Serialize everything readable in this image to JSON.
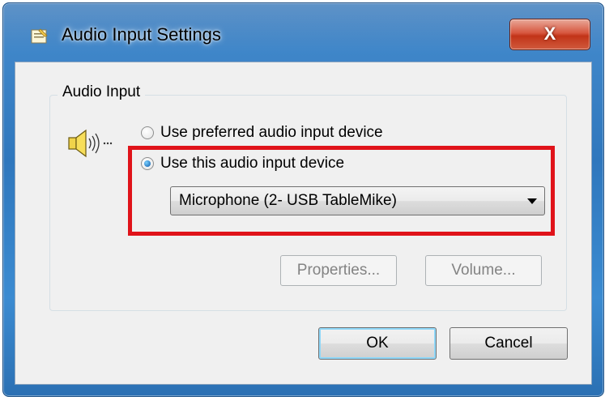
{
  "window": {
    "title": "Audio Input Settings",
    "close_label": "X",
    "icon": "dialog-icon"
  },
  "group": {
    "label": "Audio Input",
    "icon": "speaker-icon"
  },
  "options": [
    {
      "label": "Use preferred audio input device",
      "selected": false
    },
    {
      "label": "Use this audio input device",
      "selected": true
    }
  ],
  "device_select": {
    "selected": "Microphone (2- USB TableMike)"
  },
  "buttons": {
    "properties": "Properties...",
    "volume": "Volume...",
    "ok": "OK",
    "cancel": "Cancel"
  },
  "colors": {
    "highlight": "#e0131a",
    "title_bar": "#2f77bd"
  }
}
